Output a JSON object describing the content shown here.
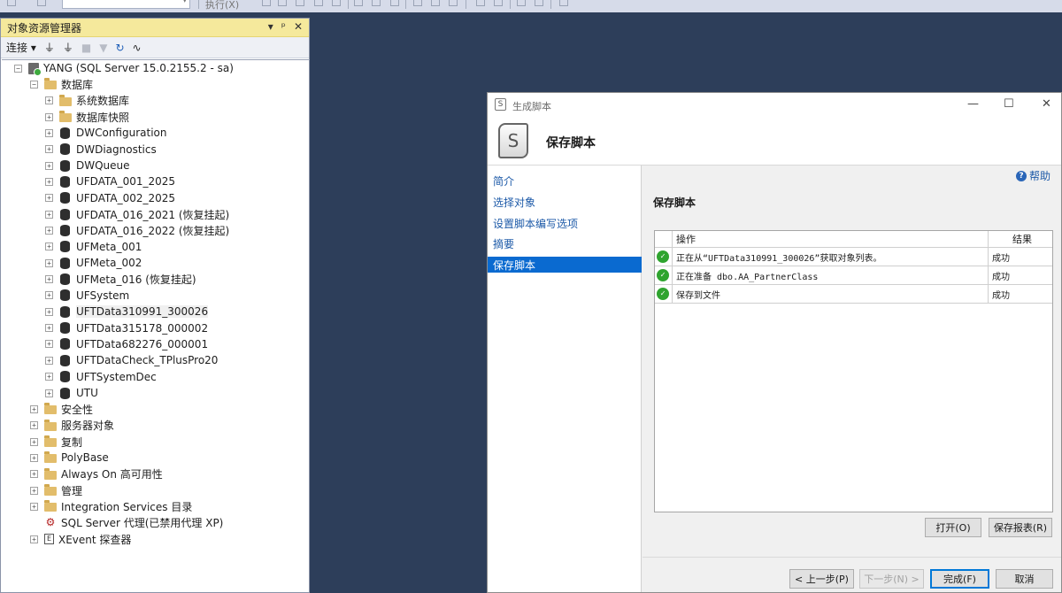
{
  "toolbar": {
    "execute_label": "执行(X)"
  },
  "object_explorer": {
    "title": "对象资源管理器",
    "title_buttons": [
      "▾",
      "ᵖ",
      "✕"
    ],
    "connect_label": "连接",
    "tree": [
      {
        "label": "YANG (SQL Server 15.0.2155.2 - sa)",
        "depth": 0,
        "icon": "server-icon",
        "expander": "⊟"
      },
      {
        "label": "数据库",
        "depth": 1,
        "icon": "folder-icon",
        "expander": "⊟"
      },
      {
        "label": "系统数据库",
        "depth": 2,
        "icon": "folder-icon",
        "expander": "⊞"
      },
      {
        "label": "数据库快照",
        "depth": 2,
        "icon": "folder-icon",
        "expander": "⊞"
      },
      {
        "label": "DWConfiguration",
        "depth": 2,
        "icon": "database-icon",
        "expander": "⊞"
      },
      {
        "label": "DWDiagnostics",
        "depth": 2,
        "icon": "database-icon",
        "expander": "⊞"
      },
      {
        "label": "DWQueue",
        "depth": 2,
        "icon": "database-icon",
        "expander": "⊞"
      },
      {
        "label": "UFDATA_001_2025",
        "depth": 2,
        "icon": "database-icon",
        "expander": "⊞"
      },
      {
        "label": "UFDATA_002_2025",
        "depth": 2,
        "icon": "database-icon",
        "expander": "⊞"
      },
      {
        "label": "UFDATA_016_2021 (恢复挂起)",
        "depth": 2,
        "icon": "database-icon",
        "expander": "⊞"
      },
      {
        "label": "UFDATA_016_2022 (恢复挂起)",
        "depth": 2,
        "icon": "database-icon",
        "expander": "⊞"
      },
      {
        "label": "UFMeta_001",
        "depth": 2,
        "icon": "database-icon",
        "expander": "⊞"
      },
      {
        "label": "UFMeta_002",
        "depth": 2,
        "icon": "database-icon",
        "expander": "⊞"
      },
      {
        "label": "UFMeta_016 (恢复挂起)",
        "depth": 2,
        "icon": "database-icon",
        "expander": "⊞"
      },
      {
        "label": "UFSystem",
        "depth": 2,
        "icon": "database-icon",
        "expander": "⊞"
      },
      {
        "label": "UFTData310991_300026",
        "depth": 2,
        "icon": "database-icon",
        "expander": "⊞",
        "highlight": true
      },
      {
        "label": "UFTData315178_000002",
        "depth": 2,
        "icon": "database-icon",
        "expander": "⊞"
      },
      {
        "label": "UFTData682276_000001",
        "depth": 2,
        "icon": "database-icon",
        "expander": "⊞"
      },
      {
        "label": "UFTDataCheck_TPlusPro20",
        "depth": 2,
        "icon": "database-icon",
        "expander": "⊞"
      },
      {
        "label": "UFTSystemDec",
        "depth": 2,
        "icon": "database-icon",
        "expander": "⊞"
      },
      {
        "label": "UTU",
        "depth": 2,
        "icon": "database-icon",
        "expander": "⊞"
      },
      {
        "label": "安全性",
        "depth": 1,
        "icon": "folder-icon",
        "expander": "⊞"
      },
      {
        "label": "服务器对象",
        "depth": 1,
        "icon": "folder-icon",
        "expander": "⊞"
      },
      {
        "label": "复制",
        "depth": 1,
        "icon": "folder-icon",
        "expander": "⊞"
      },
      {
        "label": "PolyBase",
        "depth": 1,
        "icon": "folder-icon",
        "expander": "⊞"
      },
      {
        "label": "Always On 高可用性",
        "depth": 1,
        "icon": "folder-icon",
        "expander": "⊞"
      },
      {
        "label": "管理",
        "depth": 1,
        "icon": "folder-icon",
        "expander": "⊞"
      },
      {
        "label": "Integration Services 目录",
        "depth": 1,
        "icon": "folder-icon",
        "expander": "⊞"
      },
      {
        "label": "SQL Server 代理(已禁用代理 XP)",
        "depth": 1,
        "icon": "agent-icon",
        "expander": ""
      },
      {
        "label": "XEvent 探查器",
        "depth": 1,
        "icon": "xevent-icon",
        "expander": "⊞"
      }
    ]
  },
  "dialog": {
    "window_title": "生成脚本",
    "window_controls": [
      "—",
      "☐",
      "✕"
    ],
    "header_title": "保存脚本",
    "help_label": "帮助",
    "nav": [
      {
        "label": "简介",
        "active": false
      },
      {
        "label": "选择对象",
        "active": false
      },
      {
        "label": "设置脚本编写选项",
        "active": false
      },
      {
        "label": "摘要",
        "active": false
      },
      {
        "label": "保存脚本",
        "active": true
      }
    ],
    "section_title": "保存脚本",
    "grid": {
      "columns": [
        "操作",
        "结果"
      ],
      "rows": [
        {
          "action": "正在从“UFTData310991_300026”获取对象列表。",
          "result": "成功"
        },
        {
          "action": "正在准备 dbo.AA_PartnerClass",
          "result": "成功"
        },
        {
          "action": "保存到文件",
          "result": "成功"
        }
      ]
    },
    "buttons": {
      "open": "打开(O)",
      "save_report": "保存报表(R)",
      "prev": "< 上一步(P)",
      "next": "下一步(N) >",
      "finish": "完成(F)",
      "cancel": "取消"
    }
  }
}
